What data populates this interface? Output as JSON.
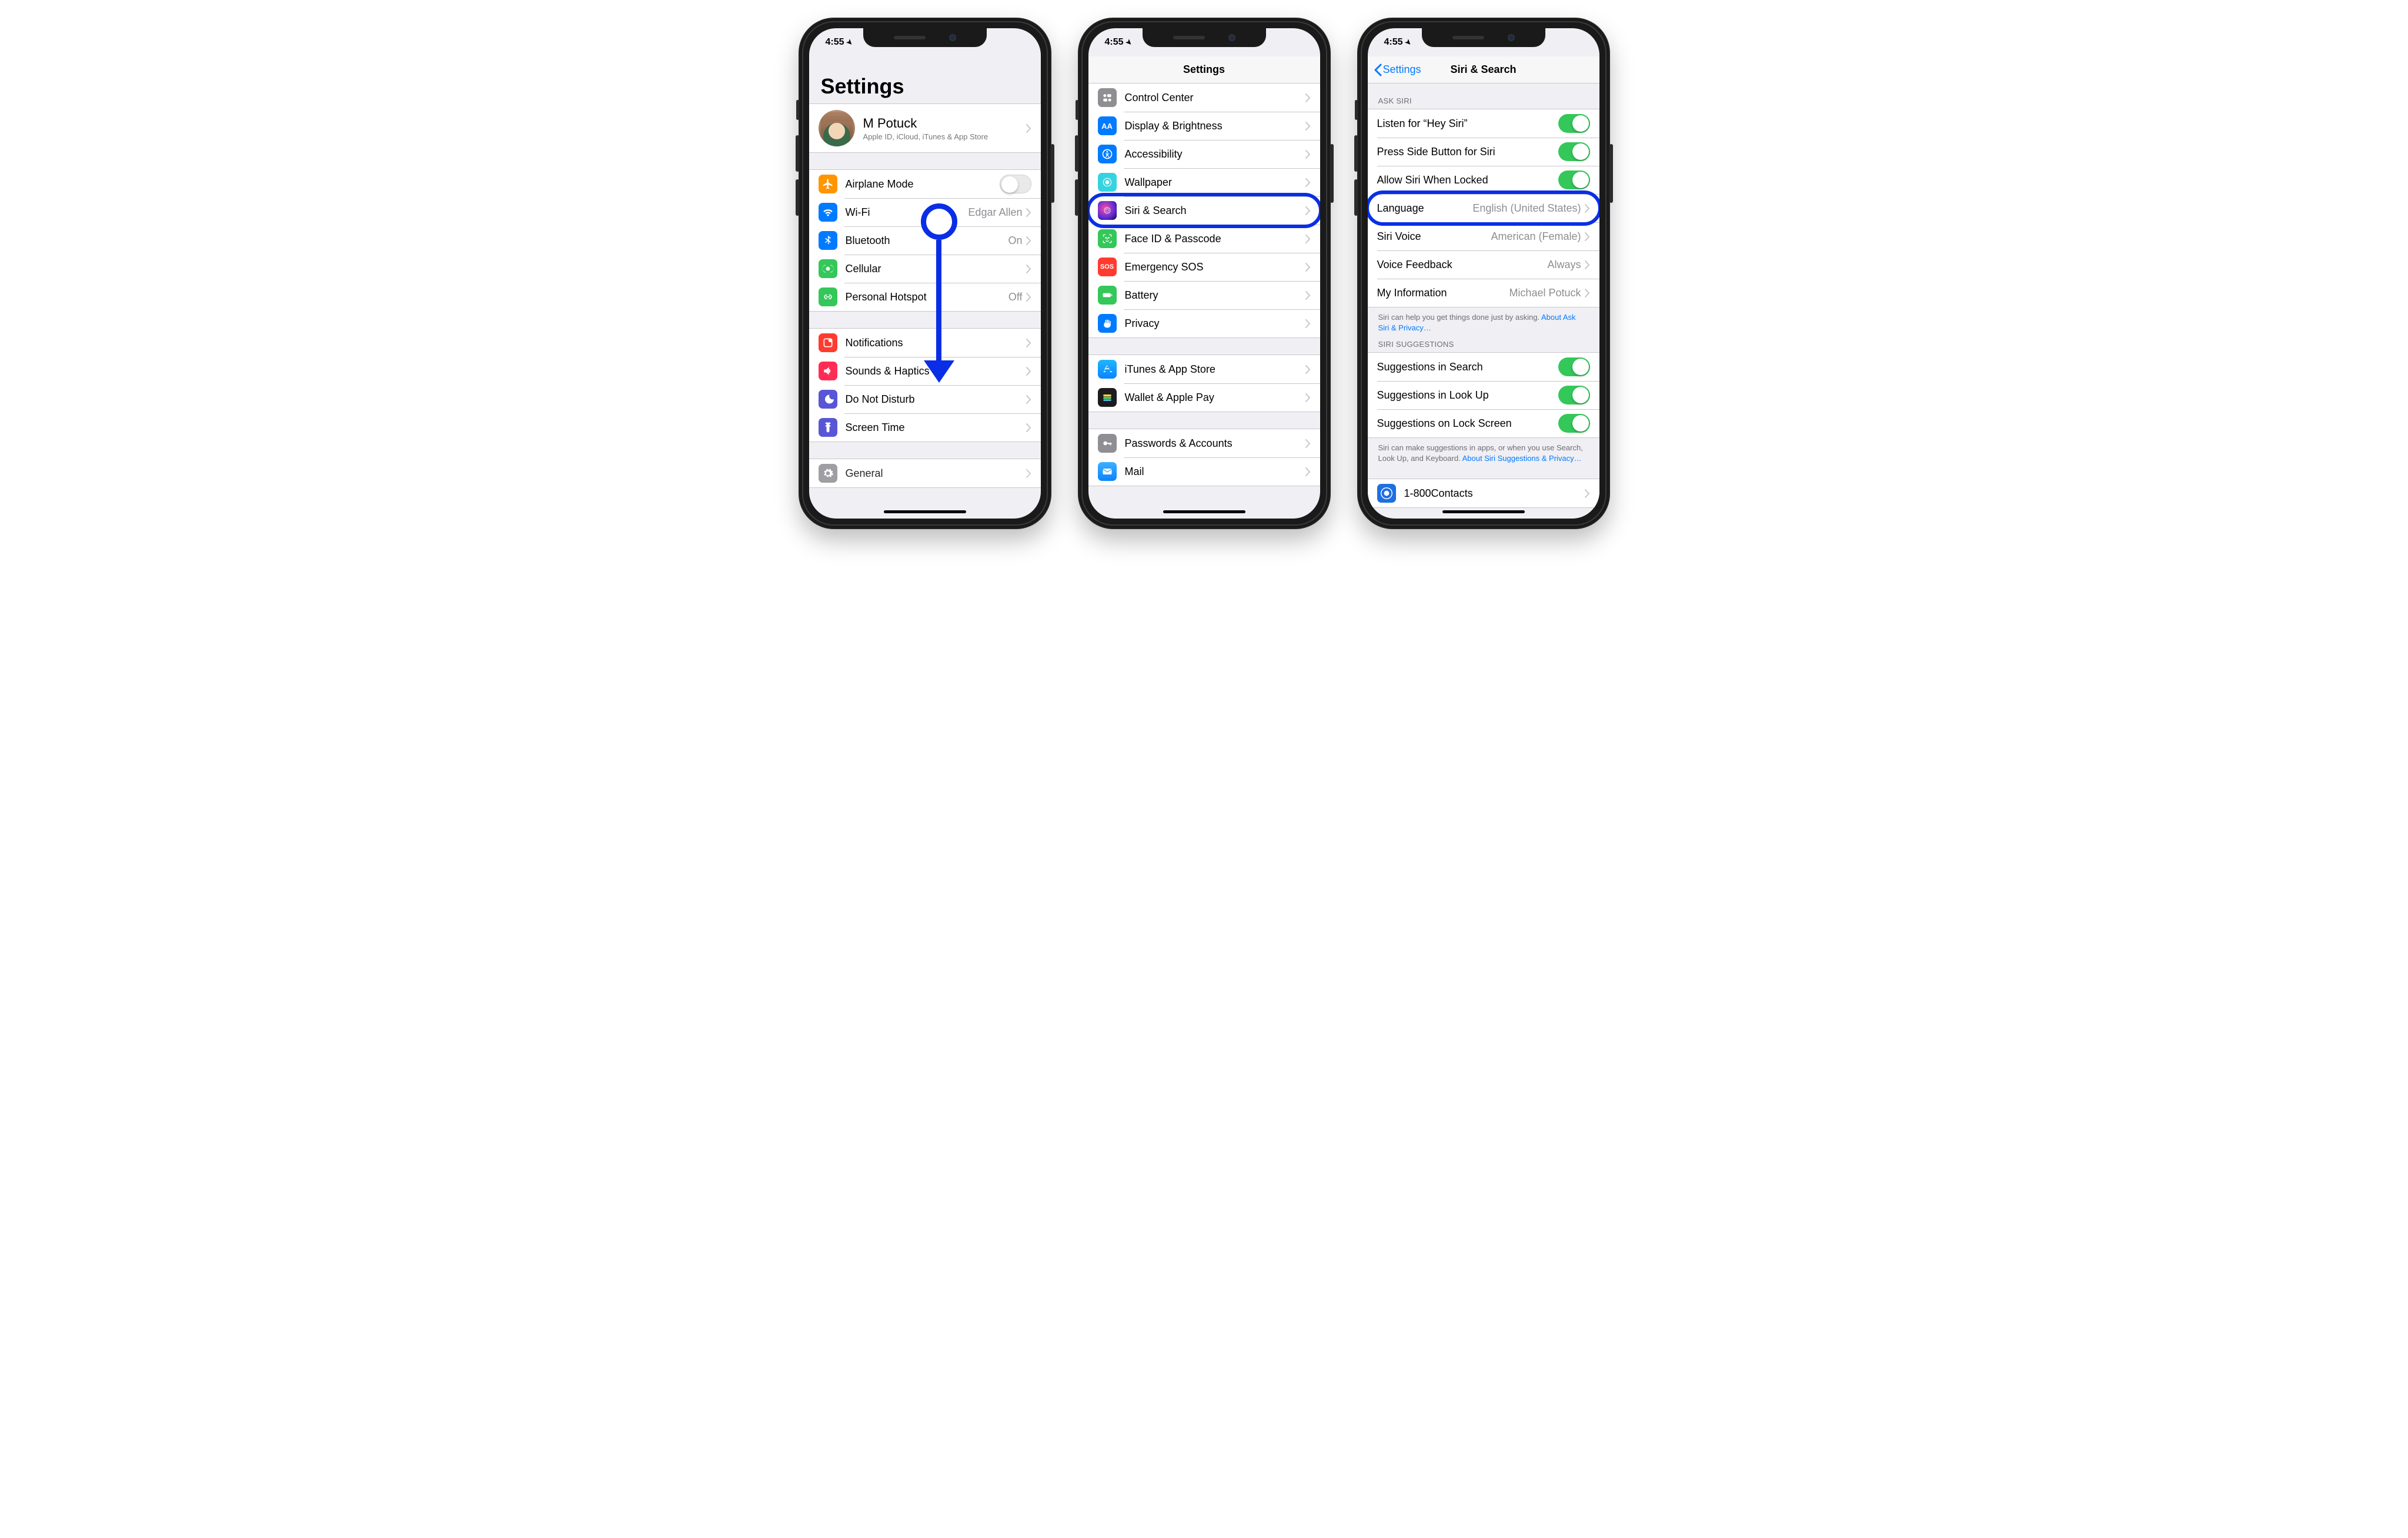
{
  "status": {
    "time": "4:55",
    "locArrow": "➤"
  },
  "phone1": {
    "title": "Settings",
    "appleId": {
      "name": "M Potuck",
      "sub": "Apple ID, iCloud, iTunes & App Store"
    },
    "g1": [
      {
        "label": "Airplane Mode",
        "toggle": "off"
      },
      {
        "label": "Wi-Fi",
        "value": "Edgar Allen"
      },
      {
        "label": "Bluetooth",
        "value": "On"
      },
      {
        "label": "Cellular"
      },
      {
        "label": "Personal Hotspot",
        "value": "Off"
      }
    ],
    "g2": [
      {
        "label": "Notifications"
      },
      {
        "label": "Sounds & Haptics"
      },
      {
        "label": "Do Not Disturb"
      },
      {
        "label": "Screen Time"
      }
    ],
    "g3": [
      {
        "label": "General"
      }
    ]
  },
  "phone2": {
    "navTitle": "Settings",
    "g1": [
      {
        "label": "Control Center"
      },
      {
        "label": "Display & Brightness"
      },
      {
        "label": "Accessibility"
      },
      {
        "label": "Wallpaper"
      },
      {
        "label": "Siri & Search",
        "highlight": true
      },
      {
        "label": "Face ID & Passcode"
      },
      {
        "label": "Emergency SOS"
      },
      {
        "label": "Battery"
      },
      {
        "label": "Privacy"
      }
    ],
    "g2": [
      {
        "label": "iTunes & App Store"
      },
      {
        "label": "Wallet & Apple Pay"
      }
    ],
    "g3": [
      {
        "label": "Passwords & Accounts"
      },
      {
        "label": "Mail"
      }
    ]
  },
  "phone3": {
    "back": "Settings",
    "navTitle": "Siri & Search",
    "askHeader": "ASK SIRI",
    "ask": [
      {
        "label": "Listen for “Hey Siri”",
        "toggle": "on"
      },
      {
        "label": "Press Side Button for Siri",
        "toggle": "on"
      },
      {
        "label": "Allow Siri When Locked",
        "toggle": "on"
      },
      {
        "label": "Language",
        "value": "English (United States)",
        "highlight": true
      },
      {
        "label": "Siri Voice",
        "value": "American (Female)"
      },
      {
        "label": "Voice Feedback",
        "value": "Always"
      },
      {
        "label": "My Information",
        "value": "Michael Potuck"
      }
    ],
    "askFooter": "Siri can help you get things done just by asking. ",
    "askFooterLink": "About Ask Siri & Privacy…",
    "sugHeader": "SIRI SUGGESTIONS",
    "sug": [
      {
        "label": "Suggestions in Search",
        "toggle": "on"
      },
      {
        "label": "Suggestions in Look Up",
        "toggle": "on"
      },
      {
        "label": "Suggestions on Lock Screen",
        "toggle": "on"
      }
    ],
    "sugFooter": "Siri can make suggestions in apps, or when you use Search, Look Up, and Keyboard. ",
    "sugFooterLink": "About Siri Suggestions & Privacy…",
    "appRow": {
      "label": "1-800Contacts"
    }
  }
}
